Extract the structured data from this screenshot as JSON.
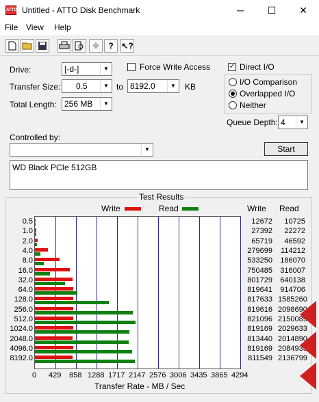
{
  "window": {
    "title": "Untitled - ATTO Disk Benchmark",
    "min": "─",
    "max": "☐",
    "close": "✕"
  },
  "menu": [
    "File",
    "View",
    "Help"
  ],
  "toolbar": [
    "new-doc-icon",
    "open-folder-icon",
    "save-icon",
    "print-icon",
    "print-preview-icon",
    "move-icon",
    "help-icon",
    "context-help-icon"
  ],
  "form": {
    "drive_label": "Drive:",
    "drive_value": "[-d-]",
    "force_write_label": "Force Write Access",
    "direct_io_label": "Direct I/O",
    "transfer_size_label": "Transfer Size:",
    "transfer_from": "0.5",
    "to_label": "to",
    "transfer_to": "8192.0",
    "kb_label": "KB",
    "total_length_label": "Total Length:",
    "total_length_value": "256 MB",
    "io_comparison_label": "I/O Comparison",
    "overlapped_io_label": "Overlapped I/O",
    "neither_label": "Neither",
    "queue_depth_label": "Queue Depth:",
    "queue_depth_value": "4",
    "controlled_by_label": "Controlled by:",
    "controlled_by_value": "",
    "start_label": "Start",
    "description": "WD Black PCIe 512GB"
  },
  "results": {
    "title": "Test Results",
    "write_legend": "Write",
    "read_legend": "Read",
    "write_col": "Write",
    "read_col": "Read",
    "xlabel": "Transfer Rate - MB / Sec",
    "colors": {
      "write": "#e01010",
      "read": "#108010",
      "grid": "#2a2aa0"
    }
  },
  "chart_data": {
    "type": "bar",
    "orientation": "horizontal",
    "categories": [
      "0.5",
      "1.0",
      "2.0",
      "4.0",
      "8.0",
      "16.0",
      "32.0",
      "64.0",
      "128.0",
      "256.0",
      "512.0",
      "1024.0",
      "2048.0",
      "4096.0",
      "8192.0"
    ],
    "series": [
      {
        "name": "Write",
        "values": [
          12672,
          27392,
          65719,
          279699,
          533250,
          750485,
          801729,
          819641,
          817633,
          819616,
          821096,
          819169,
          813440,
          819169,
          811549
        ]
      },
      {
        "name": "Read",
        "values": [
          10725,
          22272,
          46592,
          114212,
          186070,
          316007,
          640138,
          914706,
          1585260,
          2098690,
          2150089,
          2029633,
          2014890,
          2084935,
          2136799
        ]
      }
    ],
    "xticks": [
      "0",
      "429",
      "858",
      "1288",
      "1717",
      "2147",
      "2576",
      "3006",
      "3435",
      "3865",
      "4294"
    ],
    "xlim": [
      0,
      4294
    ]
  }
}
